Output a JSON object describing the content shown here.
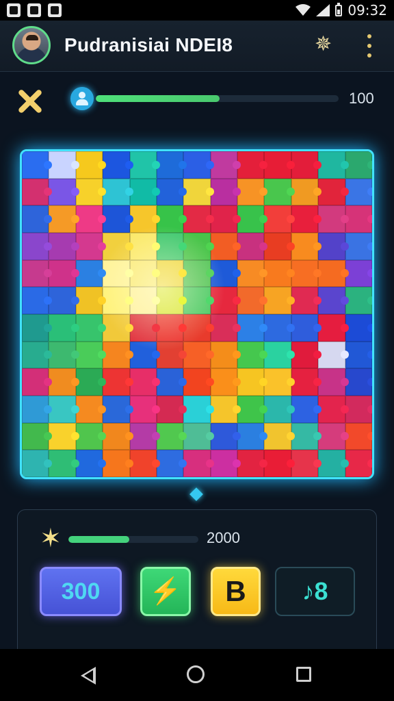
{
  "status_bar": {
    "time": "09:32",
    "icons": [
      "app-notification-icon",
      "app-notification-icon",
      "app-notification-icon",
      "wifi-icon",
      "signal-icon",
      "battery-icon"
    ]
  },
  "header": {
    "title": "Pudranisiai NDEI8",
    "star_icon": "star-icon",
    "menu_icon": "more-vert-icon"
  },
  "top_progress": {
    "value_label": "100",
    "fill_fraction": 0.51,
    "fill_color": "#4ee07a"
  },
  "bottom_panel": {
    "score_label": "2000",
    "score_fill_fraction": 0.47,
    "buttons": [
      {
        "label": "300",
        "color": "#5f72f0"
      },
      {
        "label": "⚡",
        "icon": "bolt-icon",
        "color": "#3ed877"
      },
      {
        "label": "B",
        "color": "#ffd93b"
      },
      {
        "label": "♪8",
        "icon": "music-icon",
        "color": "#0f1d26"
      }
    ]
  },
  "puzzle": {
    "columns": 13,
    "rows": 12,
    "colors": [
      "#2a6df0",
      "#c9d4ff",
      "#f6c91d",
      "#1c56e0",
      "#20c4a8",
      "#1e6bd9",
      "#2b5fe5",
      "#c03a9f",
      "#e41f3a",
      "#e71d36",
      "#e31d3a",
      "#1fb7a0",
      "#2ba86e",
      "#d3306f",
      "#7a56e6",
      "#f7d12a",
      "#2ec3d4",
      "#11bba6",
      "#2262da",
      "#f0d53b",
      "#b92fa0",
      "#f79325",
      "#49c64d",
      "#f09a22",
      "#e1243b",
      "#3a75e5",
      "#2e64da",
      "#f59a26",
      "#ee3a86",
      "#1d55d8",
      "#f6c62b",
      "#37c349",
      "#e32a45",
      "#e0234a",
      "#38c24b",
      "#f23e3a",
      "#e81f3c",
      "#d23a7e",
      "#d63378",
      "#8a46cc",
      "#a63bb0",
      "#d4398f",
      "#f1d03e",
      "#fbe96a",
      "#3fc86f",
      "#49c44a",
      "#f25d24",
      "#c8317f",
      "#e83d22",
      "#f88b1f",
      "#5342c9",
      "#3a73e3",
      "#c63a8e",
      "#cf328a",
      "#2b80e2",
      "#fff39a",
      "#fbea79",
      "#f0d740",
      "#55c55a",
      "#1e5ad8",
      "#f78b24",
      "#f87a1e",
      "#f76e23",
      "#f56b21",
      "#7c40d6",
      "#2a6ae6",
      "#2e64da",
      "#f0c225",
      "#fff27a",
      "#fff1a0",
      "#d9e63a",
      "#4ac964",
      "#e6283e",
      "#f26a2b",
      "#f7a423",
      "#e02a52",
      "#5a45ce",
      "#2bb27f",
      "#1f9a8f",
      "#2abf78",
      "#37c46c",
      "#f1c93a",
      "#e1333f",
      "#ec3532",
      "#e83b2c",
      "#d92e59",
      "#2c80e6",
      "#2d6ae0",
      "#2f5ddc",
      "#e51d3f",
      "#1c4bd6",
      "#28ac8f",
      "#3db96f",
      "#4acc59",
      "#f5851f",
      "#2160dc",
      "#e24032",
      "#f66026",
      "#f48d1a",
      "#45c74e",
      "#2ad2a0",
      "#e01b3c",
      "#d6d8f0",
      "#2158d6",
      "#d32f78",
      "#f08c20",
      "#2baa55",
      "#ed3433",
      "#e72e68",
      "#2a62d8",
      "#f2441f",
      "#fa8f1a",
      "#f6c522",
      "#fac22a",
      "#e52140",
      "#c73388",
      "#2748cd",
      "#2f9ad6",
      "#39c6c2",
      "#f58a20",
      "#2a68d9",
      "#e7307b",
      "#d42a52",
      "#2ad0d7",
      "#f5c52b",
      "#3fc44a",
      "#2bb7ab",
      "#2d62e2",
      "#e3244d",
      "#d22a5d",
      "#42b94d",
      "#f9d22c",
      "#50c54d",
      "#f1871d",
      "#b43ba6",
      "#51c84f",
      "#4fbd96",
      "#2e59da",
      "#2b7fe0",
      "#f1c42e",
      "#35b9a4",
      "#d53c7c",
      "#f2492a",
      "#2eb4b0",
      "#2fbd75",
      "#2069de",
      "#f6761c",
      "#f0432b",
      "#2e6ce0",
      "#d72f7e",
      "#cc2fa1",
      "#e22341",
      "#e91d36",
      "#e6344b",
      "#24b0a2",
      "#e72848"
    ]
  }
}
